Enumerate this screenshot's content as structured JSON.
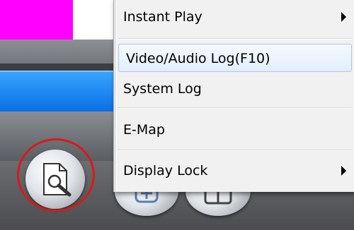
{
  "menu": {
    "items": [
      {
        "label": "Instant Play",
        "submenu": true
      },
      {
        "label": "Video/Audio Log(F10)",
        "highlighted": true
      },
      {
        "label": "System Log"
      },
      {
        "label": "E-Map"
      },
      {
        "label": "Display Lock",
        "submenu": true
      }
    ]
  },
  "toolbar": {
    "buttons": [
      {
        "name": "log-search-button",
        "icon": "document-magnifier-icon",
        "circled": true
      },
      {
        "name": "ptz-button",
        "icon": "ptz-icon"
      },
      {
        "name": "layout-button",
        "icon": "split-screen-icon"
      }
    ]
  },
  "colors": {
    "accent_magenta": "#ff00ff",
    "panel_blue": "#1e88f0",
    "highlight_ring": "#d71a1a",
    "menu_bg": "#f1f1f1",
    "menu_hover": "#e3eefc"
  }
}
